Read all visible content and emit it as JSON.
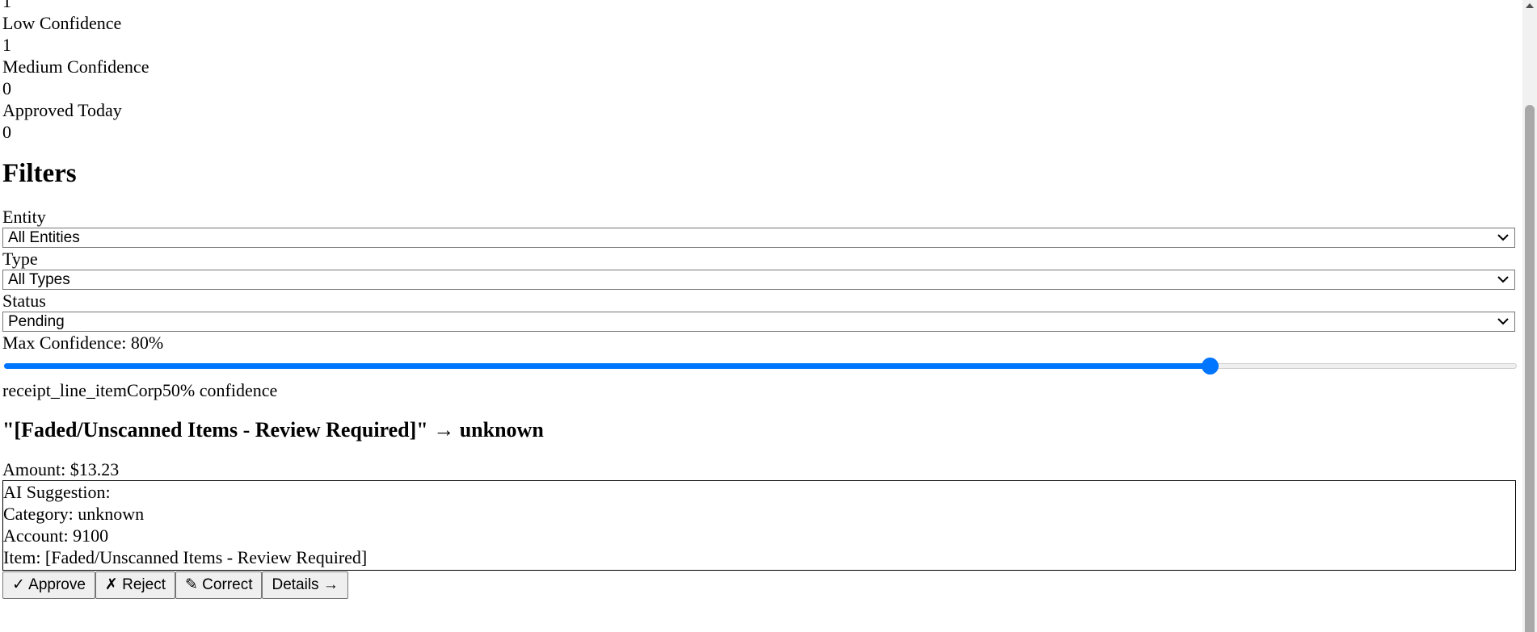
{
  "stats": [
    {
      "label": "",
      "value": "1"
    },
    {
      "label": "Low Confidence",
      "value": "1"
    },
    {
      "label": "Medium Confidence",
      "value": "0"
    },
    {
      "label": "Approved Today",
      "value": "0"
    }
  ],
  "filters": {
    "heading": "Filters",
    "entity": {
      "label": "Entity",
      "selected": "All Entities"
    },
    "type": {
      "label": "Type",
      "selected": "All Types"
    },
    "status": {
      "label": "Status",
      "selected": "Pending"
    },
    "confidence": {
      "label": "Max Confidence: 80%",
      "value_percent": 80
    }
  },
  "item": {
    "meta": "receipt_line_itemCorp50% confidence",
    "title": "\"[Faded/Unscanned Items - Review Required]\" → unknown",
    "amount": "Amount: $13.23",
    "suggestion": {
      "heading": "AI Suggestion:",
      "category": "Category: unknown",
      "account": "Account: 9100",
      "item": "Item: [Faded/Unscanned Items - Review Required]"
    },
    "buttons": {
      "approve": "✓ Approve",
      "reject": "✗ Reject",
      "correct": "✎ Correct",
      "details": "Details →"
    }
  },
  "icons": {
    "dropdown": "chevron-down-icon"
  },
  "colors": {
    "accent": "#0075ff"
  }
}
